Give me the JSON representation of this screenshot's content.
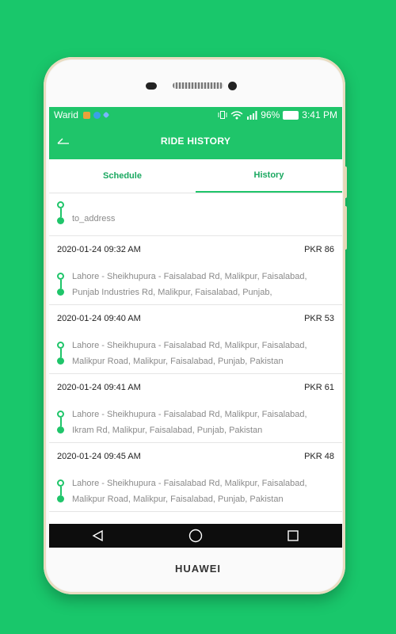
{
  "statusbar": {
    "carrier": "Warid",
    "battery": "96%",
    "time": "3:41 PM"
  },
  "appbar": {
    "title": "RIDE HISTORY"
  },
  "tabs": [
    {
      "label": "Schedule",
      "active": false
    },
    {
      "label": "History",
      "active": true
    }
  ],
  "first_item": {
    "address": "to_address"
  },
  "rides": [
    {
      "datetime": "2020-01-24 09:32 AM",
      "price": "PKR 86",
      "from": "Lahore - Sheikhupura - Faisalabad Rd, Malikpur, Faisalabad,",
      "to": "Punjab Industries Rd, Malikpur, Faisalabad, Punjab,"
    },
    {
      "datetime": "2020-01-24 09:40 AM",
      "price": "PKR 53",
      "from": "Lahore - Sheikhupura - Faisalabad Rd, Malikpur, Faisalabad,",
      "to": "Malikpur Road, Malikpur, Faisalabad, Punjab, Pakistan"
    },
    {
      "datetime": "2020-01-24 09:41 AM",
      "price": "PKR 61",
      "from": "Lahore - Sheikhupura - Faisalabad Rd, Malikpur, Faisalabad,",
      "to": "Ikram Rd, Malikpur, Faisalabad, Punjab, Pakistan"
    },
    {
      "datetime": "2020-01-24 09:45 AM",
      "price": "PKR 48",
      "from": "Lahore - Sheikhupura - Faisalabad Rd, Malikpur, Faisalabad,",
      "to": "Malikpur Road, Malikpur, Faisalabad, Punjab, Pakistan"
    }
  ],
  "navbar": {
    "icons": [
      "back-triangle-icon",
      "home-circle-icon",
      "recents-square-icon"
    ]
  },
  "device": {
    "brand": "HUAWEI"
  },
  "colors": {
    "accent": "#1fc56a",
    "background": "#19c76b"
  }
}
